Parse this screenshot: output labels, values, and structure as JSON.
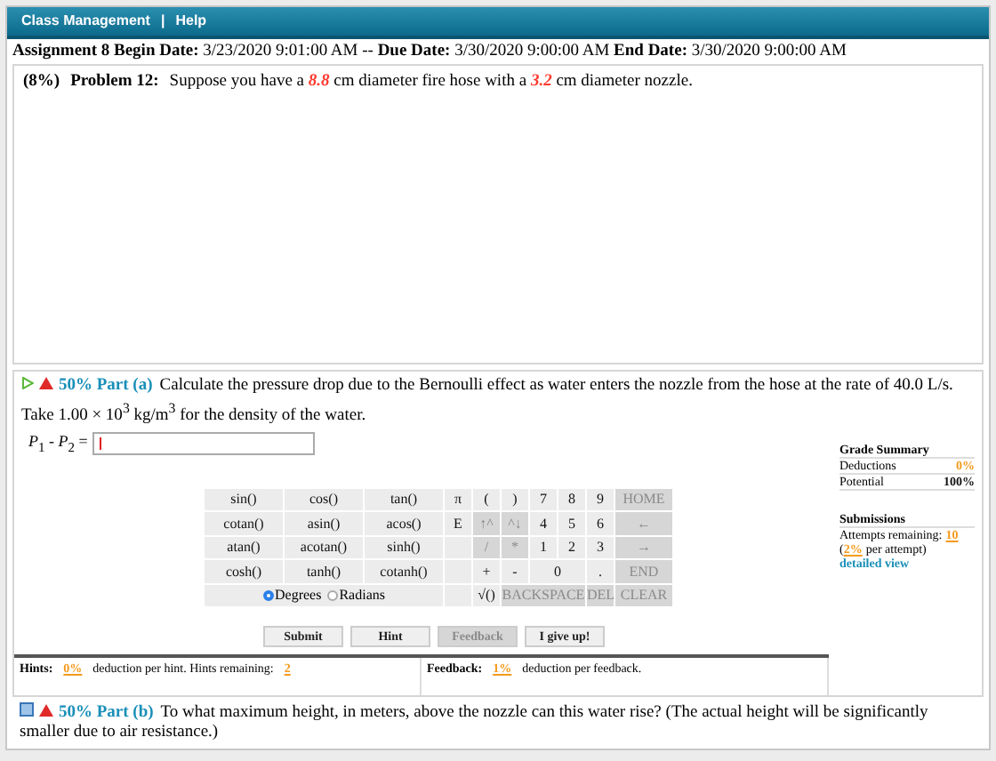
{
  "nav": {
    "items": [
      "Class Management",
      "Help"
    ],
    "separator": "|"
  },
  "assignment_line": "**Assignment 8 Begin Date:** 3/23/2020 9:01:00 AM -- **Due Date:** 3/30/2020 9:00:00 AM **End Date:** 3/30/2020 9:00:00 AM",
  "problem": {
    "weight": "(8%)",
    "title": "Problem 12:",
    "text": "Suppose you have a *8.8* cm diameter fire hose with a *3.2* cm diameter nozzle."
  },
  "part_a": {
    "percent": "50%",
    "label": "Part (a)",
    "text": "Calculate the pressure drop due to the Bernoulli effect as water enters the nozzle from the hose at the rate of 40.0 L/s. Take 1.00 × 10$^{3}$ kg/m$^{3}$ for the density of the water.",
    "equation_label": "*P*$_{1}$ - *P*$_{2}$ =",
    "keypad": [
      [
        {
          "kind": "key",
          "label": "sin()",
          "disabled": false
        },
        {
          "kind": "key",
          "label": "cos()",
          "disabled": false
        },
        {
          "kind": "key",
          "label": "tan()",
          "disabled": false
        },
        {
          "kind": "key",
          "label": "π",
          "disabled": false
        },
        {
          "kind": "key",
          "label": "(",
          "disabled": false
        },
        {
          "kind": "key",
          "label": ")",
          "disabled": false
        },
        {
          "kind": "key",
          "label": "7",
          "disabled": false
        },
        {
          "kind": "key",
          "label": "8",
          "disabled": false
        },
        {
          "kind": "key",
          "label": "9",
          "disabled": false
        },
        {
          "kind": "key",
          "label": "HOME",
          "disabled": true
        }
      ],
      [
        {
          "kind": "key",
          "label": "cotan()",
          "disabled": false
        },
        {
          "kind": "key",
          "label": "asin()",
          "disabled": false
        },
        {
          "kind": "key",
          "label": "acos()",
          "disabled": false
        },
        {
          "kind": "key",
          "label": "E",
          "disabled": false
        },
        {
          "kind": "key",
          "label": "↑^",
          "disabled": true
        },
        {
          "kind": "key",
          "label": "^↓",
          "disabled": true
        },
        {
          "kind": "key",
          "label": "4",
          "disabled": false
        },
        {
          "kind": "key",
          "label": "5",
          "disabled": false
        },
        {
          "kind": "key",
          "label": "6",
          "disabled": false
        },
        {
          "kind": "key",
          "label": "←",
          "disabled": true
        }
      ],
      [
        {
          "kind": "key",
          "label": "atan()",
          "disabled": false
        },
        {
          "kind": "key",
          "label": "acotan()",
          "disabled": false
        },
        {
          "kind": "key",
          "label": "sinh()",
          "disabled": false
        },
        {
          "kind": "blank"
        },
        {
          "kind": "key",
          "label": "/",
          "disabled": true
        },
        {
          "kind": "key",
          "label": "*",
          "disabled": true
        },
        {
          "kind": "key",
          "label": "1",
          "disabled": false
        },
        {
          "kind": "key",
          "label": "2",
          "disabled": false
        },
        {
          "kind": "key",
          "label": "3",
          "disabled": false
        },
        {
          "kind": "key",
          "label": "→",
          "disabled": true
        }
      ],
      [
        {
          "kind": "key",
          "label": "cosh()",
          "disabled": false
        },
        {
          "kind": "key",
          "label": "tanh()",
          "disabled": false
        },
        {
          "kind": "key",
          "label": "cotanh()",
          "disabled": false
        },
        {
          "kind": "blank"
        },
        {
          "kind": "key",
          "label": "+",
          "disabled": false
        },
        {
          "kind": "key",
          "label": "-",
          "disabled": false
        },
        {
          "kind": "wide",
          "label": "0",
          "disabled": false
        },
        {
          "kind": "key",
          "label": ".",
          "disabled": false
        },
        {
          "kind": "key",
          "label": "END",
          "disabled": true
        }
      ],
      [
        {
          "kind": "angle",
          "options": [
            {
              "label": "Degrees",
              "selected": true
            },
            {
              "label": "Radians",
              "selected": false
            }
          ]
        },
        {
          "kind": "blank"
        },
        {
          "kind": "key",
          "label": "√()",
          "disabled": false
        },
        {
          "kind": "long",
          "label": "BACKSPACE",
          "disabled": true
        },
        {
          "kind": "key",
          "label": "DEL",
          "disabled": true
        },
        {
          "kind": "key",
          "label": "CLEAR",
          "disabled": true
        }
      ]
    ],
    "buttons": [
      {
        "label": "Submit",
        "disabled": false
      },
      {
        "label": "Hint",
        "disabled": false
      },
      {
        "label": "Feedback",
        "disabled": true
      },
      {
        "label": "I give up!",
        "disabled": false
      }
    ],
    "grade_summary": {
      "title": "Grade Summary",
      "rows": [
        {
          "label": "Deductions",
          "value": "0%",
          "highlight": true
        },
        {
          "label": "Potential",
          "value": "100%",
          "highlight": false
        }
      ]
    },
    "submissions": {
      "title": "Submissions",
      "attempts_label": "Attempts remaining:",
      "attempts": "10",
      "penalty_open": "(",
      "penalty": "2%",
      "penalty_rest": "per attempt)",
      "link": "detailed view"
    },
    "hints": {
      "label": "Hints:",
      "value": "0%",
      "text": "deduction per hint. Hints remaining:",
      "remaining": "2"
    },
    "feedback": {
      "label": "Feedback:",
      "value": "1%",
      "text": "deduction per feedback."
    }
  },
  "part_b": {
    "percent": "50%",
    "label": "Part (b)",
    "text": "To what maximum height, in meters, above the nozzle can this water rise? (The actual height will be significantly smaller due to air resistance.)"
  }
}
